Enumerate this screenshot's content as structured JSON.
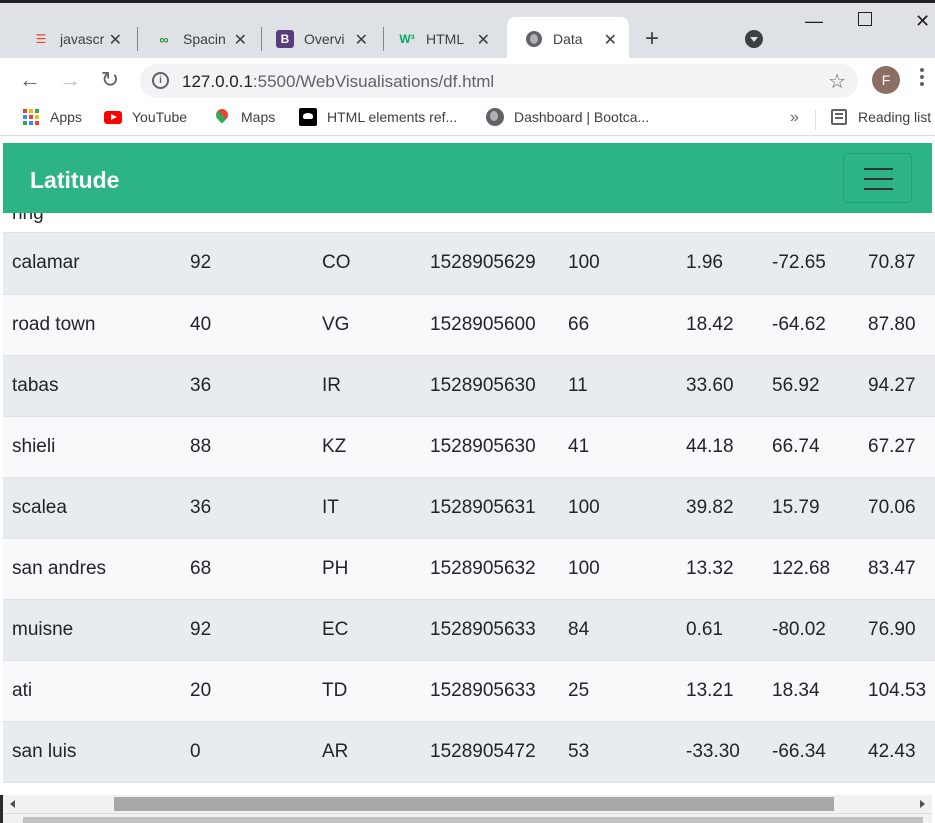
{
  "tabs": [
    {
      "title": "javascr",
      "icon": "html5-icon",
      "color": "#e44d26"
    },
    {
      "title": "Spacin",
      "icon": "geeksforgeeks-icon",
      "color": "#2f8d46"
    },
    {
      "title": "Overvi",
      "icon": "bootstrap-icon",
      "color": "#563d7c",
      "glyph": "B"
    },
    {
      "title": "HTML",
      "icon": "w3schools-icon",
      "color": "#04aa6d",
      "glyph": "W³"
    },
    {
      "title": "Data",
      "icon": "globe-icon",
      "color": "#5f6368"
    }
  ],
  "address": {
    "host": "127.0.0.1",
    "path": ":5500/WebVisualisations/df.html"
  },
  "profile": {
    "initial": "F",
    "color": "#8d6e63"
  },
  "bookmarks": {
    "apps": "Apps",
    "youtube": "YouTube",
    "maps": "Maps",
    "mdn": "HTML elements ref...",
    "dashboard": "Dashboard | Bootca...",
    "more": "»",
    "reading_list": "Reading list"
  },
  "page": {
    "brand": "Latitude",
    "accent": "#2cb485",
    "partial_cell": "ring",
    "rows": [
      [
        "calamar",
        "92",
        "CO",
        "1528905629",
        "100",
        "1.96",
        "-72.65",
        "70.87"
      ],
      [
        "road town",
        "40",
        "VG",
        "1528905600",
        "66",
        "18.42",
        "-64.62",
        "87.80"
      ],
      [
        "tabas",
        "36",
        "IR",
        "1528905630",
        "11",
        "33.60",
        "56.92",
        "94.27"
      ],
      [
        "shieli",
        "88",
        "KZ",
        "1528905630",
        "41",
        "44.18",
        "66.74",
        "67.27"
      ],
      [
        "scalea",
        "36",
        "IT",
        "1528905631",
        "100",
        "39.82",
        "15.79",
        "70.06"
      ],
      [
        "san andres",
        "68",
        "PH",
        "1528905632",
        "100",
        "13.32",
        "122.68",
        "83.47"
      ],
      [
        "muisne",
        "92",
        "EC",
        "1528905633",
        "84",
        "0.61",
        "-80.02",
        "76.90"
      ],
      [
        "ati",
        "20",
        "TD",
        "1528905633",
        "25",
        "13.21",
        "18.34",
        "104.53"
      ],
      [
        "san luis",
        "0",
        "AR",
        "1528905472",
        "53",
        "-33.30",
        "-66.34",
        "42.43"
      ]
    ]
  }
}
